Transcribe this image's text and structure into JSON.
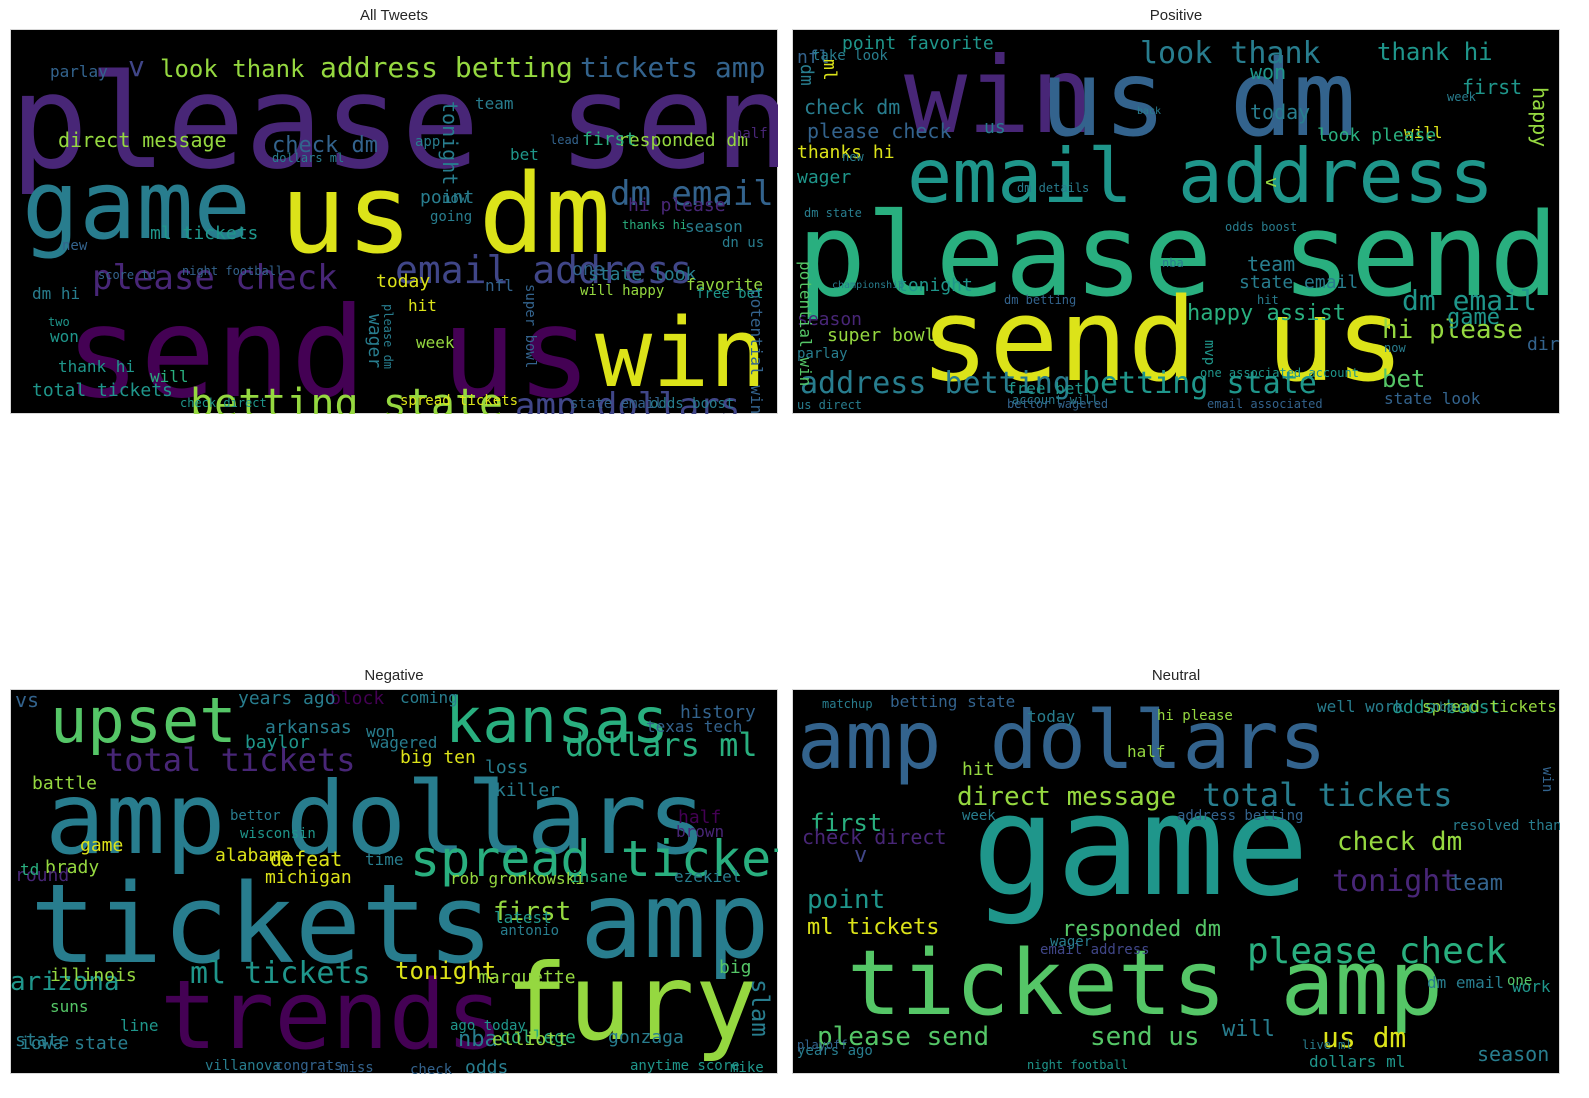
{
  "colors": {
    "background": "#ffffff",
    "cloud_background": "#000000",
    "palette": [
      "#440154",
      "#482677",
      "#404688",
      "#33638d",
      "#287d8e",
      "#1f968b",
      "#29af7f",
      "#55c667",
      "#95d840",
      "#dce319"
    ]
  },
  "panels": [
    {
      "title": "All Tweets",
      "words": [
        {
          "t": "please send",
          "c": 1
        },
        {
          "t": "game",
          "c": 4
        },
        {
          "t": "us dm",
          "c": 9
        },
        {
          "t": "send us",
          "c": 0
        },
        {
          "t": "win",
          "c": 9
        },
        {
          "t": "betting state",
          "c": 8
        },
        {
          "t": "amp dollars",
          "c": 2
        },
        {
          "t": "email address",
          "c": 2
        },
        {
          "t": "please check",
          "c": 1
        },
        {
          "t": "dm email",
          "c": 3
        },
        {
          "t": "tickets amp",
          "c": 3
        },
        {
          "t": "address betting",
          "c": 8
        },
        {
          "t": "look thank",
          "c": 8
        },
        {
          "t": "v",
          "c": 2
        },
        {
          "t": "check dm",
          "c": 3
        },
        {
          "t": "direct message",
          "c": 8
        },
        {
          "t": "responded dm",
          "c": 8
        },
        {
          "t": "hi please",
          "c": 1
        },
        {
          "t": "ml tickets",
          "c": 5
        },
        {
          "t": "total tickets",
          "c": 5
        },
        {
          "t": "tonight",
          "c": 4
        },
        {
          "t": "wager",
          "c": 4
        },
        {
          "t": "today",
          "c": 9
        },
        {
          "t": "week",
          "c": 8
        },
        {
          "t": "thank hi",
          "c": 5
        },
        {
          "t": "state look",
          "c": 4
        },
        {
          "t": "dm hi",
          "c": 4
        },
        {
          "t": "first",
          "c": 6
        },
        {
          "t": "point",
          "c": 4
        },
        {
          "t": "season",
          "c": 4
        },
        {
          "t": "parlay",
          "c": 3
        },
        {
          "t": "team",
          "c": 4
        },
        {
          "t": "bet",
          "c": 5
        },
        {
          "t": "won",
          "c": 5
        },
        {
          "t": "hit",
          "c": 9
        },
        {
          "t": "favorite",
          "c": 8
        },
        {
          "t": "potential win",
          "c": 3
        },
        {
          "t": "super bowl",
          "c": 3
        },
        {
          "t": "free bet",
          "c": 5
        },
        {
          "t": "one",
          "c": 3
        },
        {
          "t": "nfl",
          "c": 3
        },
        {
          "t": "half",
          "c": 1
        },
        {
          "t": "will",
          "c": 6
        },
        {
          "t": "will happy",
          "c": 8
        },
        {
          "t": "spread tickets",
          "c": 9
        },
        {
          "t": "odds boost",
          "c": 4
        },
        {
          "t": "state email",
          "c": 3
        },
        {
          "t": "check direct",
          "c": 5
        },
        {
          "t": "dollars ml",
          "c": 4
        },
        {
          "t": "score td",
          "c": 3
        },
        {
          "t": "night football",
          "c": 3
        },
        {
          "t": "dn us",
          "c": 4
        },
        {
          "t": "lead",
          "c": 3
        },
        {
          "t": "new",
          "c": 3
        },
        {
          "t": "now",
          "c": 4
        },
        {
          "t": "going",
          "c": 4
        },
        {
          "t": "app",
          "c": 4
        },
        {
          "t": "please dm",
          "c": 4
        },
        {
          "t": "two",
          "c": 5
        },
        {
          "t": "thanks hi",
          "c": 6
        }
      ]
    },
    {
      "title": "Positive",
      "words": [
        {
          "t": "win",
          "c": 1
        },
        {
          "t": "us dm",
          "c": 3
        },
        {
          "t": "email address",
          "c": 5
        },
        {
          "t": "please send",
          "c": 6
        },
        {
          "t": "send us",
          "c": 9
        },
        {
          "t": "address betting",
          "c": 4
        },
        {
          "t": "betting state",
          "c": 5
        },
        {
          "t": "dm email",
          "c": 5
        },
        {
          "t": "hi please",
          "c": 8
        },
        {
          "t": "look thank",
          "c": 4
        },
        {
          "t": "thank hi",
          "c": 5
        },
        {
          "t": "please check",
          "c": 3
        },
        {
          "t": "check dm",
          "c": 4
        },
        {
          "t": "thanks hi",
          "c": 9
        },
        {
          "t": "point favorite",
          "c": 5
        },
        {
          "t": "won",
          "c": 5
        },
        {
          "t": "today",
          "c": 4
        },
        {
          "t": "first",
          "c": 5
        },
        {
          "t": "happy",
          "c": 8
        },
        {
          "t": "will",
          "c": 9
        },
        {
          "t": "look please",
          "c": 6
        },
        {
          "t": "wager",
          "c": 5
        },
        {
          "t": "season",
          "c": 1
        },
        {
          "t": "super bowl",
          "c": 8
        },
        {
          "t": "tonight",
          "c": 5
        },
        {
          "t": "free bet",
          "c": 5
        },
        {
          "t": "state email",
          "c": 4
        },
        {
          "t": "happy assist",
          "c": 6
        },
        {
          "t": "game",
          "c": 5
        },
        {
          "t": "team",
          "c": 4
        },
        {
          "t": "bet",
          "c": 7
        },
        {
          "t": "state look",
          "c": 3
        },
        {
          "t": "potential win",
          "c": 7
        },
        {
          "t": "nfl",
          "c": 3
        },
        {
          "t": "ml",
          "c": 9
        },
        {
          "t": "dm",
          "c": 4
        },
        {
          "t": "us",
          "c": 4
        },
        {
          "t": "v",
          "c": 8
        },
        {
          "t": "parlay",
          "c": 4
        },
        {
          "t": "direct message",
          "c": 3
        },
        {
          "t": "now",
          "c": 4
        },
        {
          "t": "account will",
          "c": 4
        },
        {
          "t": "bettor wagered",
          "c": 3
        },
        {
          "t": "email associated",
          "c": 3
        },
        {
          "t": "us direct",
          "c": 4
        },
        {
          "t": "dm betting",
          "c": 3
        },
        {
          "t": "one associated account",
          "c": 5
        },
        {
          "t": "dm details",
          "c": 4
        },
        {
          "t": "new",
          "c": 4
        },
        {
          "t": "dm state",
          "c": 4
        },
        {
          "t": "week",
          "c": 4
        },
        {
          "t": "odds boost",
          "c": 4
        },
        {
          "t": "mvp",
          "c": 5
        },
        {
          "t": "hit",
          "c": 4
        },
        {
          "t": "nba",
          "c": 4
        },
        {
          "t": "championship",
          "c": 4
        },
        {
          "t": "back",
          "c": 4
        },
        {
          "t": "take look",
          "c": 4
        }
      ]
    },
    {
      "title": "Negative",
      "words": [
        {
          "t": "amp dollars",
          "c": 4
        },
        {
          "t": "tickets",
          "c": 4
        },
        {
          "t": "amp",
          "c": 4
        },
        {
          "t": "trends",
          "c": 0
        },
        {
          "t": "fury",
          "c": 8
        },
        {
          "t": "upset",
          "c": 7
        },
        {
          "t": "kansas",
          "c": 6
        },
        {
          "t": "spread tickets",
          "c": 6
        },
        {
          "t": "total tickets",
          "c": 1
        },
        {
          "t": "dollars ml",
          "c": 6
        },
        {
          "t": "ml tickets",
          "c": 5
        },
        {
          "t": "arizona",
          "c": 5
        },
        {
          "t": "first",
          "c": 8
        },
        {
          "t": "tonight",
          "c": 9
        },
        {
          "t": "illinois",
          "c": 8
        },
        {
          "t": "history",
          "c": 3
        },
        {
          "t": "texas tech",
          "c": 3
        },
        {
          "t": "marquette",
          "c": 8
        },
        {
          "t": "michigan",
          "c": 9
        },
        {
          "t": "defeat",
          "c": 9
        },
        {
          "t": "alabama",
          "c": 9
        },
        {
          "t": "game",
          "c": 9
        },
        {
          "t": "battle",
          "c": 8
        },
        {
          "t": "vs",
          "c": 3
        },
        {
          "t": "arkansas",
          "c": 4
        },
        {
          "t": "baylor",
          "c": 5
        },
        {
          "t": "wagered",
          "c": 4
        },
        {
          "t": "big ten",
          "c": 9
        },
        {
          "t": "iowa state",
          "c": 4
        },
        {
          "t": "state",
          "c": 4
        },
        {
          "t": "college",
          "c": 6
        },
        {
          "t": "nba",
          "c": 4
        },
        {
          "t": "odds",
          "c": 4
        },
        {
          "t": "elliott",
          "c": 8
        },
        {
          "t": "gonzaga",
          "c": 4
        },
        {
          "t": "slam",
          "c": 4
        },
        {
          "t": "big",
          "c": 7
        },
        {
          "t": "suns",
          "c": 7
        },
        {
          "t": "brady",
          "c": 8
        },
        {
          "t": "round",
          "c": 1
        },
        {
          "t": "td",
          "c": 6
        },
        {
          "t": "rob gronkowski",
          "c": 8
        },
        {
          "t": "ezekiel",
          "c": 4
        },
        {
          "t": "insane",
          "c": 6
        },
        {
          "t": "half",
          "c": 0
        },
        {
          "t": "brown",
          "c": 1
        },
        {
          "t": "time",
          "c": 4
        },
        {
          "t": "block",
          "c": 0
        },
        {
          "t": "years ago",
          "c": 4
        },
        {
          "t": "won",
          "c": 4
        },
        {
          "t": "coming",
          "c": 4
        },
        {
          "t": "line",
          "c": 5
        },
        {
          "t": "loss",
          "c": 4
        },
        {
          "t": "killer",
          "c": 4
        },
        {
          "t": "bettor",
          "c": 4
        },
        {
          "t": "wisconsin",
          "c": 5
        },
        {
          "t": "latest",
          "c": 5
        },
        {
          "t": "antonio",
          "c": 4
        },
        {
          "t": "ago today",
          "c": 5
        },
        {
          "t": "villanova",
          "c": 4
        },
        {
          "t": "congrats",
          "c": 3
        },
        {
          "t": "miss",
          "c": 3
        },
        {
          "t": "check",
          "c": 3
        },
        {
          "t": "anytime score",
          "c": 5
        },
        {
          "t": "mike",
          "c": 5
        }
      ]
    },
    {
      "title": "Neutral",
      "words": [
        {
          "t": "amp dollars",
          "c": 3
        },
        {
          "t": "game",
          "c": 5
        },
        {
          "t": "tickets amp",
          "c": 7
        },
        {
          "t": "total tickets",
          "c": 4
        },
        {
          "t": "direct message",
          "c": 8
        },
        {
          "t": "please check",
          "c": 6
        },
        {
          "t": "check dm",
          "c": 8
        },
        {
          "t": "tonight",
          "c": 1
        },
        {
          "t": "team",
          "c": 3
        },
        {
          "t": "please send",
          "c": 7
        },
        {
          "t": "send us",
          "c": 7
        },
        {
          "t": "us dm",
          "c": 9
        },
        {
          "t": "responded dm",
          "c": 7
        },
        {
          "t": "ml tickets",
          "c": 9
        },
        {
          "t": "point",
          "c": 5
        },
        {
          "t": "first",
          "c": 6
        },
        {
          "t": "check direct",
          "c": 1
        },
        {
          "t": "hit",
          "c": 8
        },
        {
          "t": "v",
          "c": 2
        },
        {
          "t": "will",
          "c": 4
        },
        {
          "t": "season",
          "c": 4
        },
        {
          "t": "dollars ml",
          "c": 5
        },
        {
          "t": "odds boost",
          "c": 5
        },
        {
          "t": "spread tickets",
          "c": 8
        },
        {
          "t": "well work",
          "c": 4
        },
        {
          "t": "betting state",
          "c": 3
        },
        {
          "t": "today",
          "c": 4
        },
        {
          "t": "half",
          "c": 8
        },
        {
          "t": "address betting",
          "c": 3
        },
        {
          "t": "resolved thank",
          "c": 4
        },
        {
          "t": "dm email",
          "c": 4
        },
        {
          "t": "email address",
          "c": 2
        },
        {
          "t": "wager",
          "c": 4
        },
        {
          "t": "work resolved",
          "c": 5
        },
        {
          "t": "one",
          "c": 7
        },
        {
          "t": "win",
          "c": 3
        },
        {
          "t": "week",
          "c": 4
        },
        {
          "t": "hi please",
          "c": 8
        },
        {
          "t": "years ago",
          "c": 4
        },
        {
          "t": "nba",
          "c": 4
        },
        {
          "t": "playoff",
          "c": 3
        },
        {
          "t": "night football",
          "c": 5
        },
        {
          "t": "live ml",
          "c": 4
        },
        {
          "t": "matchup",
          "c": 4
        }
      ]
    }
  ]
}
